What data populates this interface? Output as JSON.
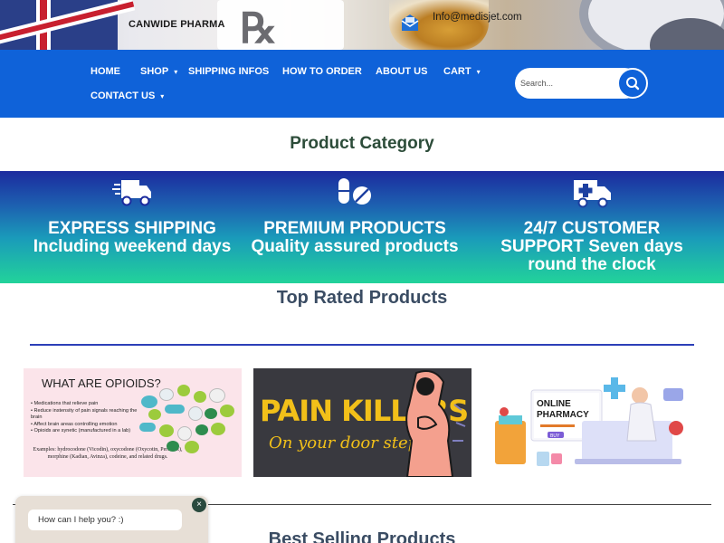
{
  "header": {
    "brand": "CANWIDE PHARMA",
    "email": "Info@medisjet.com",
    "mail_icon": "envelope-icon"
  },
  "nav": {
    "items": [
      {
        "label": "HOME",
        "has_dropdown": false
      },
      {
        "label": "SHOP",
        "has_dropdown": true
      },
      {
        "label": "SHIPPING INFOS",
        "has_dropdown": false
      },
      {
        "label": "HOW TO ORDER",
        "has_dropdown": false
      },
      {
        "label": "ABOUT US",
        "has_dropdown": false
      },
      {
        "label": "CART",
        "has_dropdown": true
      },
      {
        "label": "CONTACT US",
        "has_dropdown": true
      }
    ],
    "search_placeholder": "Search...",
    "search_icon": "search-icon",
    "color": "#0f62d9"
  },
  "sections": {
    "category_title": "Product Category",
    "top_rated_title": "Top Rated Products",
    "best_selling_title": "Best Selling Products"
  },
  "features": [
    {
      "icon": "delivery-truck-icon",
      "title": "EXPRESS SHIPPING",
      "subtitle": "Including weekend days"
    },
    {
      "icon": "pills-icon",
      "title": "PREMIUM PRODUCTS",
      "subtitle": "Quality assured products"
    },
    {
      "icon": "ambulance-icon",
      "title": "24/7 CUSTOMER",
      "subtitle": "SUPPORT Seven days round the clock"
    }
  ],
  "products": [
    {
      "image_title": "WHAT ARE OPIOIDS?",
      "bullets": [
        "Medications that relieve pain",
        "Reduce instensity of pain signals reaching the brain",
        "Affect brain areas controlling emotion",
        "Opioids are synetic (manufactured in a lab)"
      ],
      "examples": "Examples: hydrocodone (Vicodin), oxycodone (Oxycotin, Percocet), morphine (Kadian, Avinza), codeine, and related drugs."
    },
    {
      "line1": "PAIN KILLERS",
      "line2": "On your door step"
    },
    {
      "line1": "ONLINE",
      "line2": "PHARMACY",
      "button": "BUY"
    }
  ],
  "chat": {
    "message": "How can I help you? :)",
    "close_symbol": "×"
  },
  "colors": {
    "nav_blue": "#0f62d9",
    "heading_green": "#2c4c39",
    "heading_slate": "#3a4c63",
    "band_top": "#1c2b9e",
    "band_bottom": "#22d39a"
  }
}
